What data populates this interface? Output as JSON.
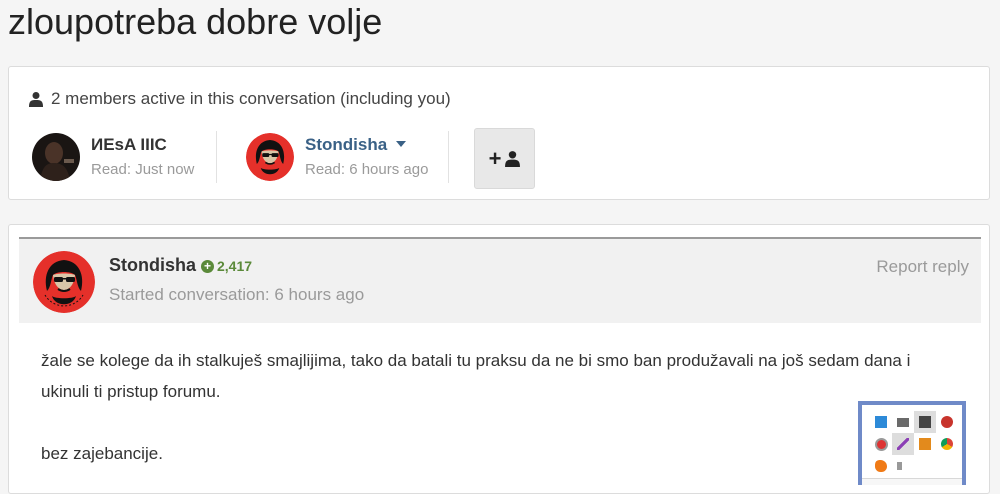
{
  "page": {
    "title": "zloupotreba dobre volje"
  },
  "members": {
    "heading": "2 members active in this conversation (including you)",
    "list": [
      {
        "name": "ИЕsA IIIC",
        "read": "Read: Just now"
      },
      {
        "name": "Stondisha",
        "read": "Read: 6 hours ago"
      }
    ],
    "add_label": "+"
  },
  "post": {
    "author": "Stondisha",
    "reputation": "2,417",
    "meta": "Started conversation: 6 hours ago",
    "report_label": "Report reply",
    "paragraphs": [
      "žale se kolege da ih stalkuješ smajlijima, tako da batali tu praksu da ne bi smo ban produžavali na još sedam dana i ukinuli ti pristup forumu.",
      "bez zajebancije."
    ]
  },
  "tray_icons": [
    "network-icon",
    "monitor-icon",
    "display-icon",
    "app-red-icon",
    "security-icon",
    "pen-icon",
    "package-icon",
    "chrome-icon",
    "avast-icon",
    "volume-icon"
  ],
  "colors": {
    "link": "#3a6186",
    "reputation": "#5b8a3a",
    "tray_border": "#6f8ac8",
    "avatar_red": "#e5302a"
  }
}
